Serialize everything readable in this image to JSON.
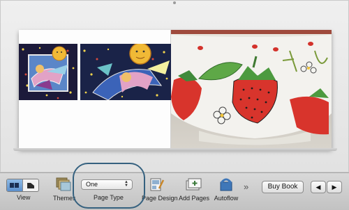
{
  "toolbar": {
    "view_label": "View",
    "themes_label": "Themes",
    "page_type_label": "Page Type",
    "page_type_value": "One",
    "page_design_label": "Page Design",
    "add_pages_label": "Add Pages",
    "autoflow_label": "Autoflow",
    "overflow_glyph": "»",
    "buy_book_label": "Buy Book",
    "prev_glyph": "◀",
    "next_glyph": "▶"
  },
  "colors": {
    "highlight_ring": "#35617f",
    "selected_segment": "#5b8fcc"
  },
  "icons": {
    "view_single": "single-page-view-icon",
    "view_spread": "spread-view-icon",
    "themes": "themes-icon",
    "page_design": "page-design-icon",
    "add_pages": "add-pages-icon",
    "autoflow": "autoflow-icon"
  }
}
